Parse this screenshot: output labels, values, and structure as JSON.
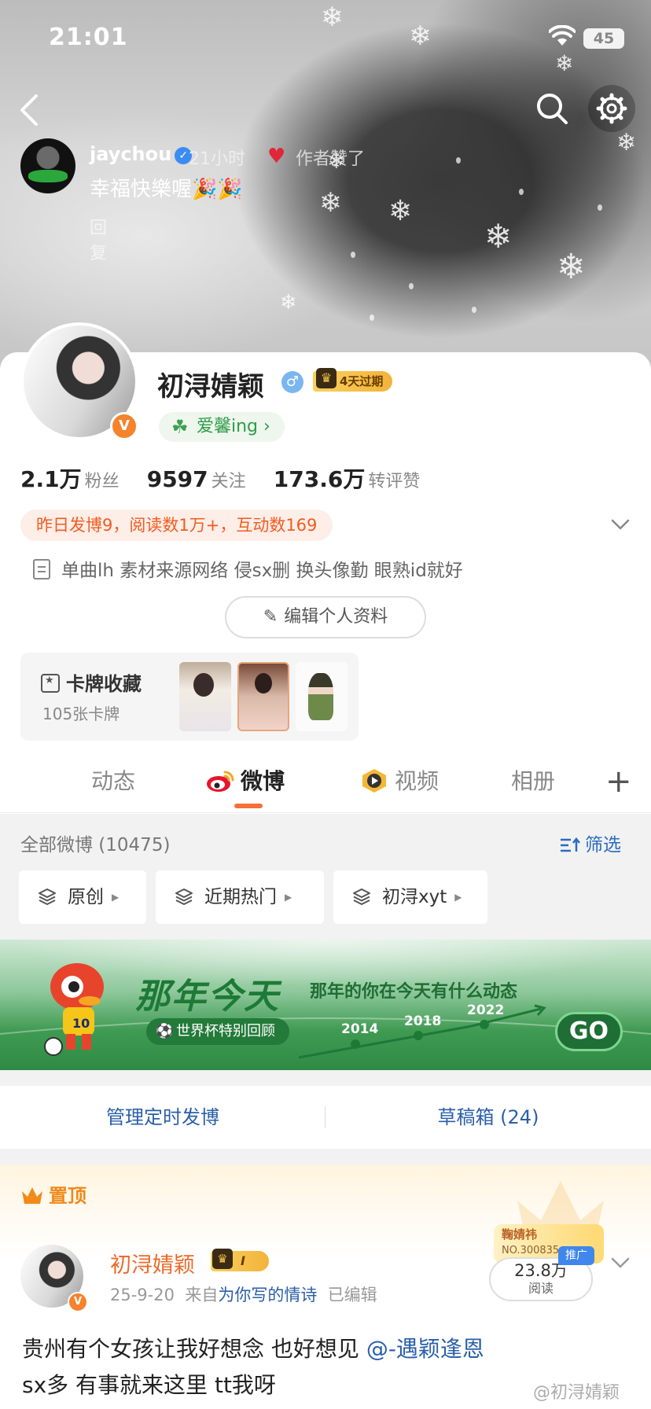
{
  "status_bar": {
    "time": "21:01",
    "battery": "45"
  },
  "comment": {
    "username": "jaychou",
    "time": "21小时",
    "author_liked": "作者赞了",
    "text": "幸福快樂喔",
    "reply": "回复"
  },
  "profile": {
    "name": "初浔婧颖",
    "vip_badge": "4天过期",
    "tag": "爱馨ing ›",
    "stats": [
      {
        "num": "2.1万",
        "label": "粉丝"
      },
      {
        "num": "9597",
        "label": "关注"
      },
      {
        "num": "173.6万",
        "label": "转评赞"
      }
    ],
    "yesterday": "昨日发博9，阅读数1万+，互动数169",
    "bio": "单曲lh 素材来源网络 侵sx删 换头像勤 眼熟id就好",
    "edit_button": "编辑个人资料",
    "cards": {
      "title": "卡牌收藏",
      "count": "105张卡牌"
    }
  },
  "tabs": [
    {
      "label": "动态"
    },
    {
      "label": "微博"
    },
    {
      "label": "视频"
    },
    {
      "label": "相册"
    }
  ],
  "filter": {
    "all": "全部微博 (10475)",
    "filter_label": "筛选",
    "chips": [
      "原创",
      "近期热门",
      "初浔xyt"
    ]
  },
  "banner": {
    "title": "那年今天",
    "subtitle": "那年的你在今天有什么动态",
    "pill": "世界杯特别回顾",
    "years": [
      "2014",
      "2018",
      "2022"
    ],
    "go": "GO"
  },
  "manage": {
    "left": "管理定时发博",
    "right": "草稿箱 (24)"
  },
  "post": {
    "pinned": "置顶",
    "author": "初浔婧颖",
    "badge_level": "I",
    "date": "25-9-20",
    "from_prefix": "来自",
    "source": "为你写的情诗",
    "edited": "已编辑",
    "reads_num": "23.8万",
    "reads_label": "阅读",
    "promo": "推广",
    "sticker_name": "鞠婧祎",
    "sticker_no": "NO.300835",
    "line1_text": "贵州有个女孩让我好想念 也好想见 ",
    "line1_mention": "@-遇颖逢恩",
    "line2": "sx多 有事就来这里 tt我呀",
    "watermark": "@初浔婧颖"
  },
  "colors": {
    "accent_orange": "#f5703a",
    "link_blue": "#2a5fa8",
    "tag_green": "#2f9c48"
  }
}
